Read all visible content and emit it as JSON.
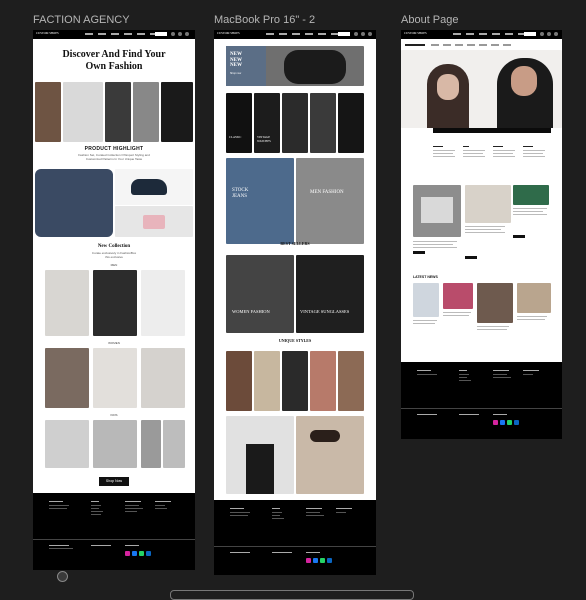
{
  "canvas": {
    "frames": [
      {
        "label": "FACTION AGENCY"
      },
      {
        "label": "MacBook Pro 16\" - 2"
      },
      {
        "label": "About Page"
      }
    ]
  },
  "frame1": {
    "hero_title_line1": "Discover And Find Your",
    "hero_title_line2": "Own Fashion",
    "product_highlight_title": "PRODUCT HIGHLIGHT",
    "product_highlight_desc_1": "Fashion Set, Curated Collection Of Expert Styling and",
    "product_highlight_desc_2": "Customized Patterns In Your Unique Taste",
    "new_collection_title": "New Collection",
    "new_collection_sub_1": "Curate exclusively in FashionBox",
    "new_collection_sub_2": "this exclusive",
    "men_label": "MEN",
    "women_label": "WOMEN",
    "kids_label": "KIDS",
    "shop_now": "Shop Now"
  },
  "frame2": {
    "new_label": "NEW",
    "new_sub": "Shop now",
    "cat_labels": [
      "CLASSIC",
      "VINTAGE WATCHES",
      "",
      "",
      ""
    ],
    "banner_text_1": "STOCK",
    "banner_text_2": "JEANS",
    "banner_text_3": "MEN FASHION",
    "best_sellers": "BEST SELLERS",
    "women_fashion": "WOMEN FASHION",
    "vintage_sunglasses": "VINTAGE SUNGLASSES",
    "unique_styles": "UNIQUE STYLES"
  },
  "frame3": {
    "latest_news": "LATEST NEWS"
  },
  "colors": {
    "canvas": "#1e1e1e",
    "label": "#b5b5b5",
    "footer": "#000000"
  }
}
